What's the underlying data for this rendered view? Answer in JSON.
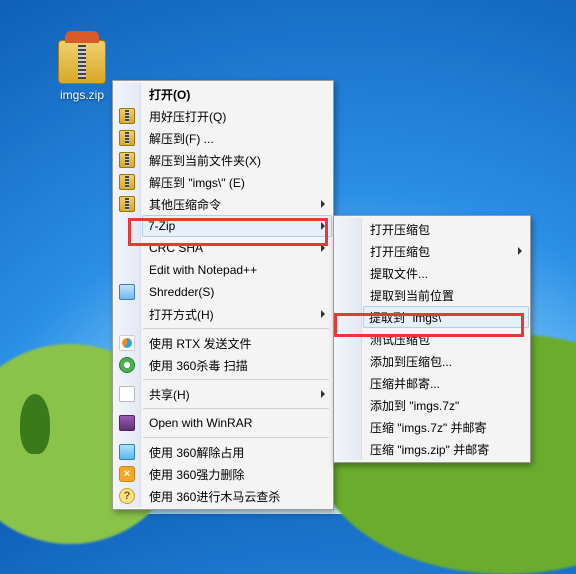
{
  "desktop": {
    "file_label": "imgs.zip"
  },
  "menu1": {
    "open": "打开(O)",
    "haozip": "用好压打开(Q)",
    "extractTo": "解压到(F) ...",
    "extractHere": "解压到当前文件夹(X)",
    "extractImgs": "解压到 \"imgs\\\" (E)",
    "otherComp": "其他压缩命令",
    "sevenZip": "7-Zip",
    "crcSha": "CRC SHA",
    "editNpp": "Edit with Notepad++",
    "shredder": "Shredder(S)",
    "openWith": "打开方式(H)",
    "rtxSend": "使用 RTX 发送文件",
    "scan360": "使用 360杀毒 扫描",
    "share": "共享(H)",
    "winrar": "Open with WinRAR",
    "unlock360": "使用 360解除占用",
    "forceDel360": "使用 360强力删除",
    "cloud360": "使用 360进行木马云查杀"
  },
  "menu2": {
    "openArchive": "打开压缩包",
    "openArchiveSub": "打开压缩包",
    "extractFiles": "提取文件...",
    "extractHere": "提取到当前位置",
    "extractImgs": "提取到 \"imgs\\\"",
    "test": "测试压缩包",
    "addTo": "添加到压缩包...",
    "compressMail": "压缩并邮寄...",
    "add7z": "添加到 \"imgs.7z\"",
    "compress7z": "压缩 \"imgs.7z\" 并邮寄",
    "compressZip": "压缩 \"imgs.zip\" 并邮寄"
  }
}
